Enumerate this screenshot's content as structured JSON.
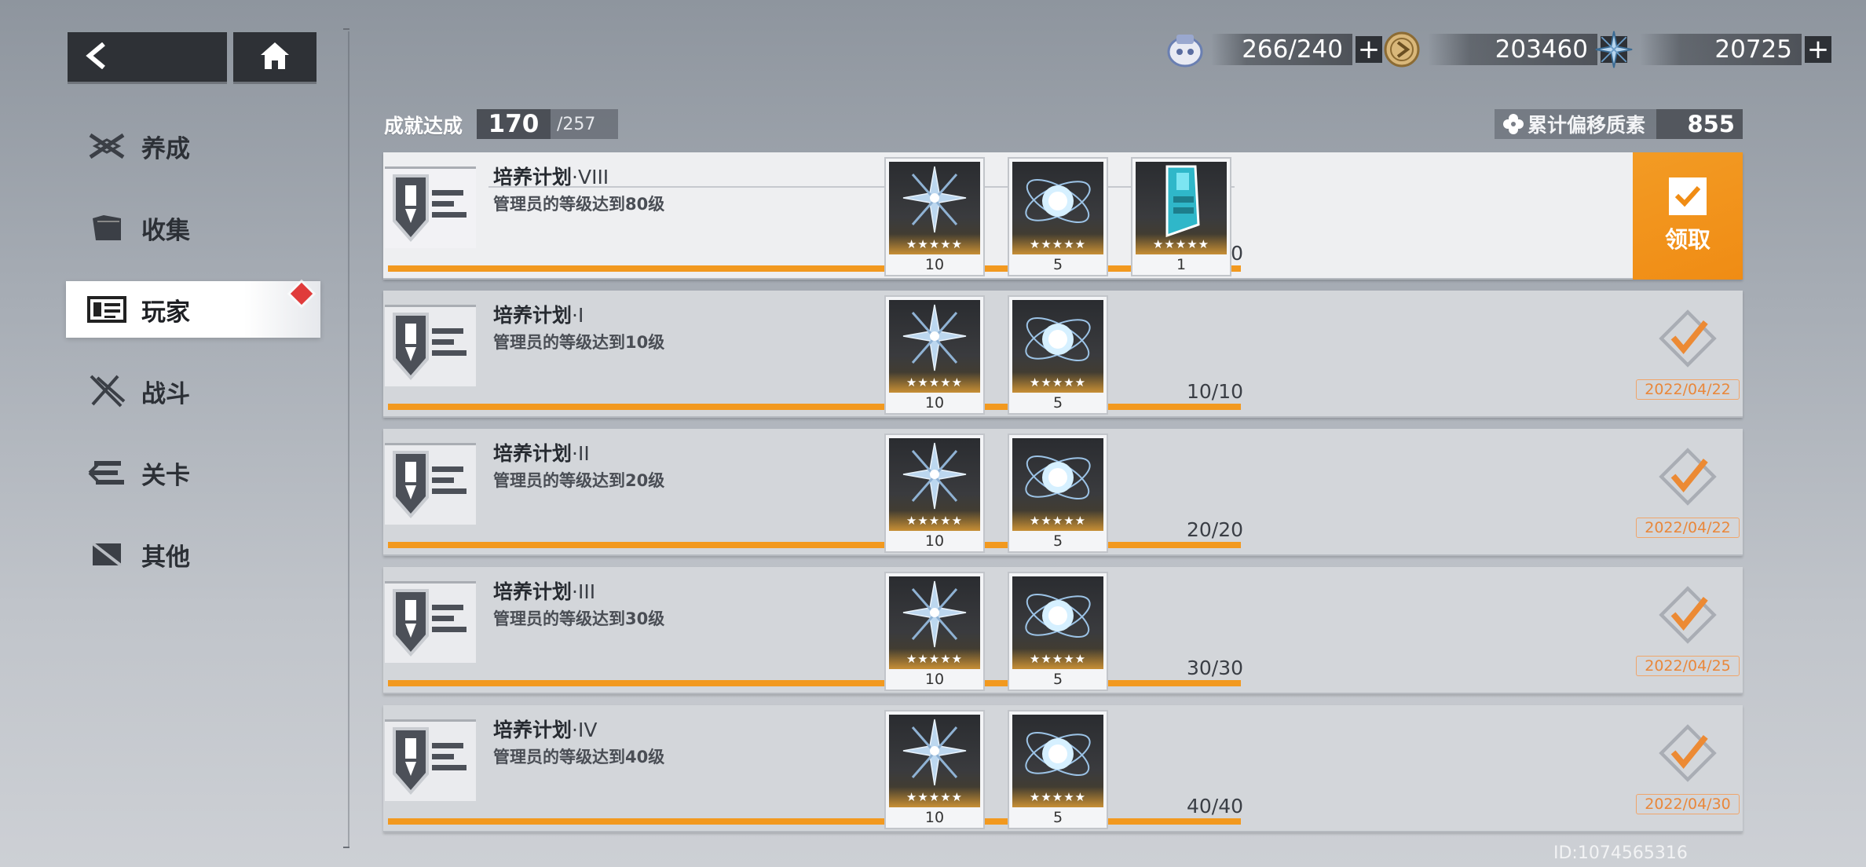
{
  "nav": {
    "back_icon": "chevron-left-icon",
    "home_icon": "home-icon"
  },
  "sidebar": {
    "items": [
      {
        "label": "养成",
        "icon": "crossed-blades-icon",
        "active": false
      },
      {
        "label": "收集",
        "icon": "folder-icon",
        "active": false
      },
      {
        "label": "玩家",
        "icon": "id-card-icon",
        "active": true
      },
      {
        "label": "战斗",
        "icon": "swords-icon",
        "active": false
      },
      {
        "label": "关卡",
        "icon": "stage-icon",
        "active": false
      },
      {
        "label": "其他",
        "icon": "misc-icon",
        "active": false
      }
    ]
  },
  "currencies": {
    "stamina": {
      "value": "266/240",
      "icon": "stamina-icon"
    },
    "coin": {
      "value": "203460",
      "icon": "coin-icon"
    },
    "crystal": {
      "value": "20725",
      "icon": "crystal-icon"
    },
    "plus": "+"
  },
  "header": {
    "achievement_label": "成就达成",
    "achieved": "170",
    "total": "/257",
    "drift_label": "累计偏移质素",
    "drift_value": "855"
  },
  "achievements": [
    {
      "name": "培养计划",
      "tier": "·VIII",
      "desc": "管理员的等级达到80级",
      "progress_text": "80/80",
      "progress": 1.0,
      "rewards": [
        {
          "type": "crystal",
          "stars": "★★★★★",
          "qty": "10"
        },
        {
          "type": "orb",
          "stars": "★★★★★",
          "qty": "5"
        },
        {
          "type": "chip",
          "stars": "★★★★★",
          "qty": "1"
        }
      ],
      "status": "claimable",
      "claim_label": "领取"
    },
    {
      "name": "培养计划",
      "tier": "·I",
      "desc": "管理员的等级达到10级",
      "progress_text": "10/10",
      "progress": 1.0,
      "rewards": [
        {
          "type": "crystal",
          "stars": "★★★★★",
          "qty": "10"
        },
        {
          "type": "orb",
          "stars": "★★★★★",
          "qty": "5"
        }
      ],
      "status": "claimed",
      "date": "2022/04/22"
    },
    {
      "name": "培养计划",
      "tier": "·II",
      "desc": "管理员的等级达到20级",
      "progress_text": "20/20",
      "progress": 1.0,
      "rewards": [
        {
          "type": "crystal",
          "stars": "★★★★★",
          "qty": "10"
        },
        {
          "type": "orb",
          "stars": "★★★★★",
          "qty": "5"
        }
      ],
      "status": "claimed",
      "date": "2022/04/22"
    },
    {
      "name": "培养计划",
      "tier": "·III",
      "desc": "管理员的等级达到30级",
      "progress_text": "30/30",
      "progress": 1.0,
      "rewards": [
        {
          "type": "crystal",
          "stars": "★★★★★",
          "qty": "10"
        },
        {
          "type": "orb",
          "stars": "★★★★★",
          "qty": "5"
        }
      ],
      "status": "claimed",
      "date": "2022/04/25"
    },
    {
      "name": "培养计划",
      "tier": "·IV",
      "desc": "管理员的等级达到40级",
      "progress_text": "40/40",
      "progress": 1.0,
      "rewards": [
        {
          "type": "crystal",
          "stars": "★★★★★",
          "qty": "10"
        },
        {
          "type": "orb",
          "stars": "★★★★★",
          "qty": "5"
        }
      ],
      "status": "claimed",
      "date": "2022/04/30"
    }
  ],
  "uid": "ID:1074565316",
  "colors": {
    "accent": "#f2991f",
    "date": "#e9873a",
    "dark_button": "#2e3136"
  }
}
